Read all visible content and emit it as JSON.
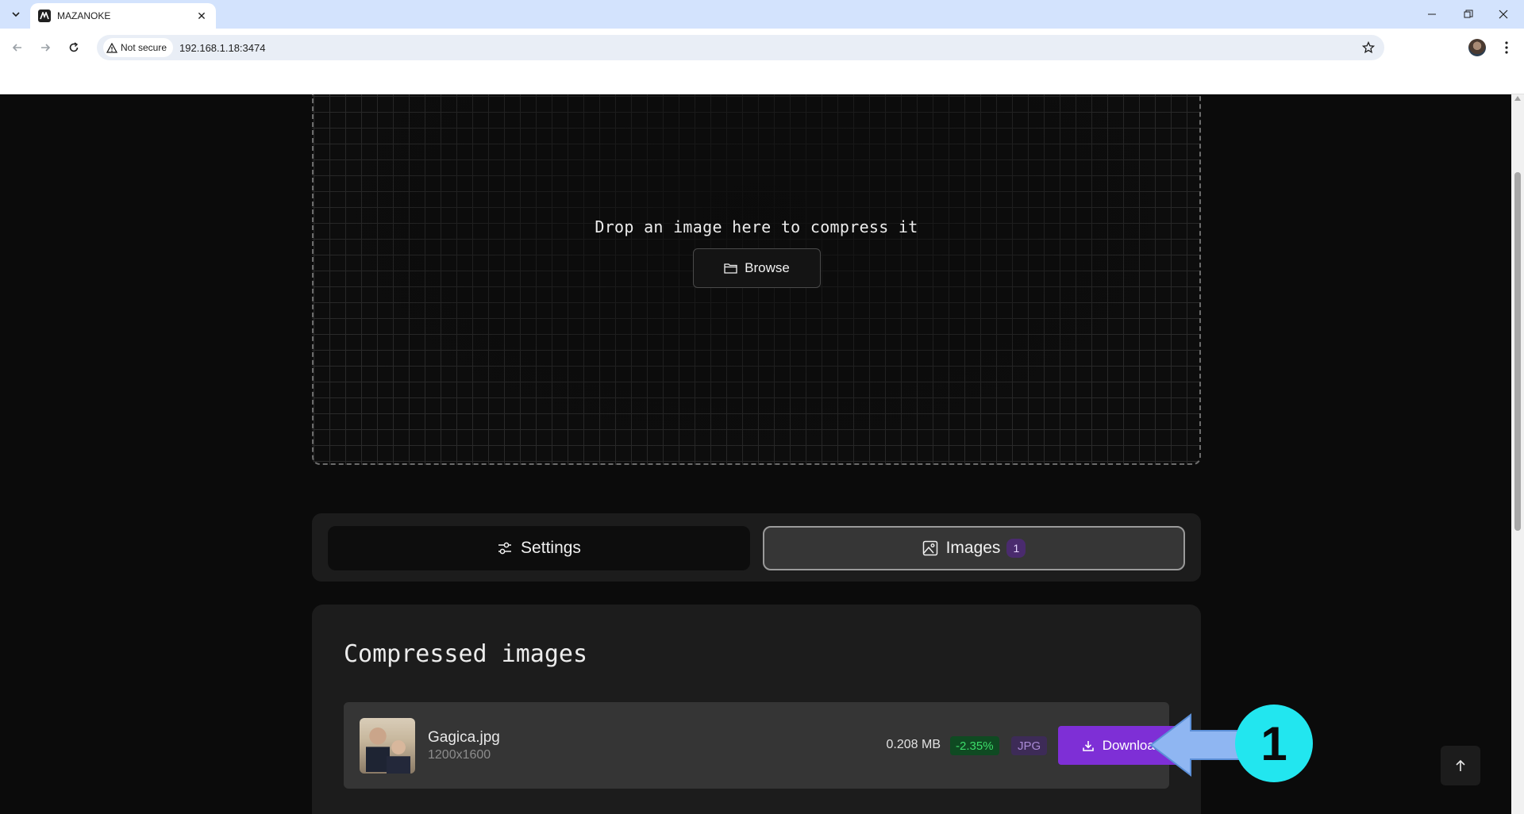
{
  "browser": {
    "tab_title": "MAZANOKE",
    "security_label": "Not secure",
    "url": "192.168.1.18:3474"
  },
  "dropzone": {
    "prompt": "Drop an image here to compress it",
    "browse_label": "Browse"
  },
  "tabs": {
    "settings_label": "Settings",
    "images_label": "Images",
    "images_count": "1"
  },
  "results": {
    "title": "Compressed images",
    "files": [
      {
        "name": "Gagica.jpg",
        "dimensions": "1200x1600",
        "size": "0.208 MB",
        "change": "-2.35%",
        "format": "JPG",
        "download_label": "Download"
      }
    ]
  },
  "annotation": {
    "number": "1"
  },
  "colors": {
    "accent": "#7e2fd6",
    "success": "#3ddc6a",
    "annotation": "#22e6ef"
  }
}
